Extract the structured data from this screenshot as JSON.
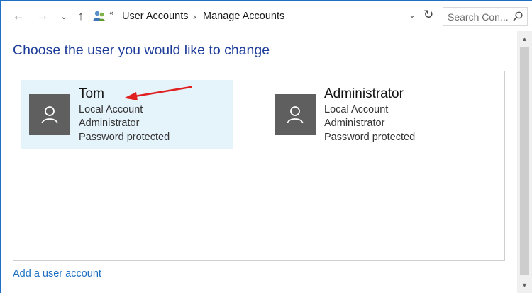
{
  "nav": {
    "back_glyph": "←",
    "forward_glyph": "→",
    "recent_glyph": "⌄",
    "up_glyph": "↑",
    "breadcrumb_sep1": "«",
    "breadcrumb": [
      {
        "label": "User Accounts"
      },
      {
        "label": "Manage Accounts"
      }
    ],
    "breadcrumb_sep": "›",
    "address_dropdown_glyph": "⌄",
    "refresh_glyph": "↻",
    "search_placeholder": "Search Con..."
  },
  "page": {
    "title": "Choose the user you would like to change",
    "add_user_link": "Add a user account"
  },
  "accounts": [
    {
      "name": "Tom",
      "type": "Local Account",
      "role": "Administrator",
      "security": "Password protected",
      "selected": true
    },
    {
      "name": "Administrator",
      "type": "Local Account",
      "role": "Administrator",
      "security": "Password protected",
      "selected": false
    }
  ],
  "icons": {
    "avatar": "user-silhouette-icon",
    "breadcrumb_root": "control-panel-users-icon",
    "search": "magnifier-icon"
  },
  "colors": {
    "title_blue": "#1e3d9a",
    "link_blue": "#1a6fc2",
    "selection_bg": "#e5f3fb",
    "avatar_bg": "#5f5f5f",
    "annotation_red": "#e02020"
  },
  "scrollbar": {
    "up_glyph": "▲",
    "down_glyph": "▼"
  }
}
